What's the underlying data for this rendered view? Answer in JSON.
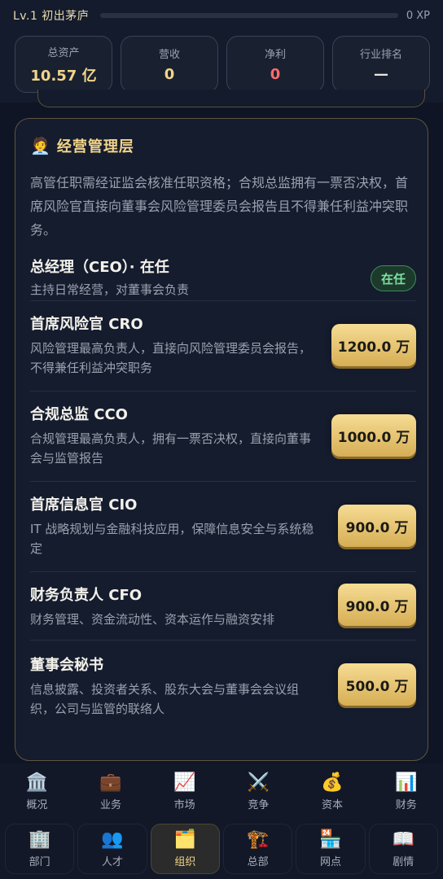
{
  "header": {
    "level": "Lv.1 初出茅庐",
    "xp": "0 XP",
    "xp_progress": 0
  },
  "stats": [
    {
      "label": "总资产",
      "value": "10.57 亿"
    },
    {
      "label": "营收",
      "value": "0"
    },
    {
      "label": "净利",
      "value": "0"
    },
    {
      "label": "行业排名",
      "value": "—"
    }
  ],
  "card": {
    "icon": "🧑‍💼",
    "title": "经营管理层",
    "description": "高管任职需经证监会核准任职资格；合规总监拥有一票否决权，首席风险官直接向董事会风险管理委员会报告且不得兼任利益冲突职务。",
    "rows": [
      {
        "name": "总经理（CEO）· 在任",
        "desc": "主持日常经营，对董事会负责",
        "status": "在任"
      },
      {
        "name": "首席风险官 CRO",
        "desc": "风险管理最高负责人，直接向风险管理委员会报告，不得兼任利益冲突职务",
        "price": "1200.0 万"
      },
      {
        "name": "合规总监 CCO",
        "desc": "合规管理最高负责人，拥有一票否决权，直接向董事会与监管报告",
        "price": "1000.0 万"
      },
      {
        "name": "首席信息官 CIO",
        "desc": "IT 战略规划与金融科技应用，保障信息安全与系统稳定",
        "price": "900.0 万"
      },
      {
        "name": "财务负责人 CFO",
        "desc": "财务管理、资金流动性、资本运作与融资安排",
        "price": "900.0 万"
      },
      {
        "name": "董事会秘书",
        "desc": "信息披露、投资者关系、股东大会与董事会会议组织，公司与监管的联络人",
        "price": "500.0 万"
      }
    ]
  },
  "nav_primary": [
    {
      "icon": "🏛️",
      "label": "概况"
    },
    {
      "icon": "💼",
      "label": "业务"
    },
    {
      "icon": "📈",
      "label": "市场"
    },
    {
      "icon": "⚔️",
      "label": "竞争"
    },
    {
      "icon": "💰",
      "label": "资本"
    },
    {
      "icon": "📊",
      "label": "财务"
    }
  ],
  "nav_secondary": [
    {
      "icon": "🏢",
      "label": "部门"
    },
    {
      "icon": "👥",
      "label": "人才"
    },
    {
      "icon": "🗂️",
      "label": "组织"
    },
    {
      "icon": "🏗️",
      "label": "总部"
    },
    {
      "icon": "🏪",
      "label": "网点"
    },
    {
      "icon": "📖",
      "label": "剧情"
    }
  ]
}
